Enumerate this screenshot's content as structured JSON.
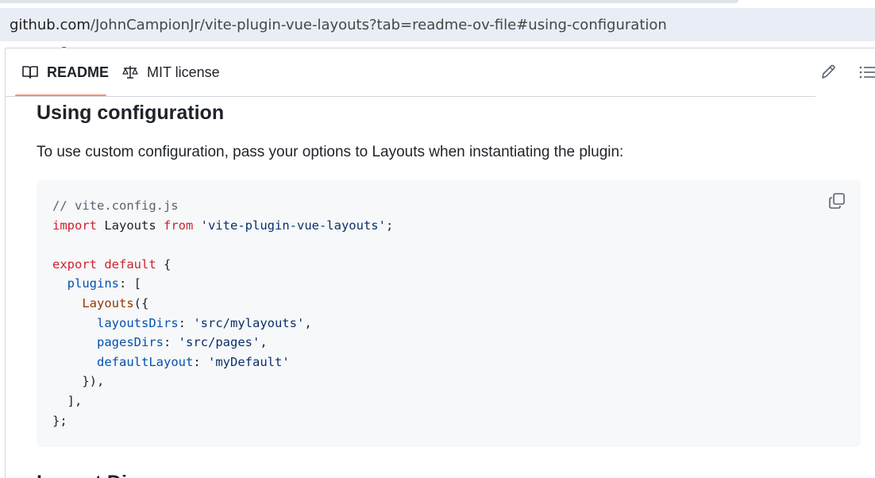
{
  "browser": {
    "url_host": "github.com",
    "url_rest": "/JohnCampionJr/vite-plugin-vue-layouts?tab=readme-ov-file#using-configuration"
  },
  "tabs": [
    {
      "label": "README",
      "icon": "book-icon",
      "active": true
    },
    {
      "label": "MIT license",
      "icon": "scale-icon",
      "active": false
    }
  ],
  "toolbar": {
    "edit_icon": "pencil-icon",
    "toc_icon": "list-unordered-icon"
  },
  "content": {
    "heading": "Using configuration",
    "paragraph": "To use custom configuration, pass your options to Layouts when instantiating the plugin:",
    "code": {
      "copy_icon": "copy-icon",
      "lines": [
        "// vite.config.js",
        "import Layouts from 'vite-plugin-vue-layouts';",
        "",
        "export default {",
        "  plugins: [",
        "    Layouts({",
        "      layoutsDirs: 'src/mylayouts',",
        "      pagesDirs: 'src/pages',",
        "      defaultLayout: 'myDefault'",
        "    }),",
        "  ],",
        "};"
      ]
    },
    "next_heading_partial": "Layout Dirs"
  },
  "colors": {
    "active_tab_underline": "#fd8c73",
    "code_background": "#f6f8fa",
    "keyword": "#cf222e",
    "string": "#0a3069",
    "property": "#0550ae",
    "function": "#953800",
    "comment": "#59636e"
  }
}
